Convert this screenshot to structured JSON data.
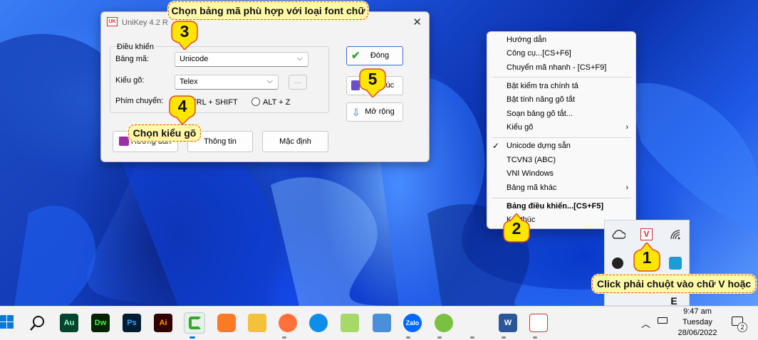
{
  "unikey": {
    "title": "UniKey 4.2 R",
    "close_icon": "✕",
    "group_title": "Điều khiển",
    "bang_ma_label": "Bảng mã:",
    "bang_ma_value": "Unicode",
    "kieu_go_label": "Kiểu gõ:",
    "kieu_go_value": "Telex",
    "ellipsis_button": "...",
    "phim_chuyen_label": "Phím chuyển:",
    "ctrl_shift_option": "CTRL + SHIFT",
    "alt_z_option": "ALT + Z",
    "dong_button": "Đóng",
    "ket_thuc_button": "Kết thúc",
    "mo_rong_button": "Mở rộng",
    "huong_dan_button": "Hướng dẫn",
    "thong_tin_button": "Thông tin",
    "mac_dinh_button": "Mặc định"
  },
  "callouts": {
    "bang_ma_hint": "Chọn bảng mã phù hợp với loại font chữ",
    "kieu_go_hint": "Chọn kiểu gõ",
    "click_hint": "Click phải chuột vào chữ V hoặc E"
  },
  "steps": [
    "1",
    "2",
    "3",
    "4",
    "5"
  ],
  "context_menu": {
    "items": [
      "Hướng dẫn",
      "Công cụ...[CS+F6]",
      "Chuyển mã nhanh - [CS+F9]",
      "Bật kiểm tra chính tả",
      "Bật tính năng gõ tắt",
      "Soạn bảng gõ tắt...",
      "Kiểu gõ",
      "Unicode dựng sẵn",
      "TCVN3 (ABC)",
      "VNI Windows",
      "Bảng mã khác",
      "Bảng điều khiển...[CS+F5]",
      "Kết thúc"
    ],
    "checked_item": "Unicode dựng sẵn"
  },
  "tray": {
    "unikey_icon_letter": "V"
  },
  "taskbar": {
    "apps": [
      {
        "name": "windows-start",
        "label": ""
      },
      {
        "name": "search",
        "label": ""
      },
      {
        "name": "audition",
        "label": "Au"
      },
      {
        "name": "dreamweaver",
        "label": "Dw"
      },
      {
        "name": "photoshop",
        "label": "Ps"
      },
      {
        "name": "illustrator",
        "label": "Ai"
      },
      {
        "name": "camtasia",
        "label": ""
      },
      {
        "name": "xampp",
        "label": ""
      },
      {
        "name": "file-explorer",
        "label": ""
      },
      {
        "name": "firefox",
        "label": ""
      },
      {
        "name": "teamviewer",
        "label": ""
      },
      {
        "name": "notepad-plus",
        "label": ""
      },
      {
        "name": "paint-tool",
        "label": ""
      },
      {
        "name": "zalo",
        "label": "Zalo"
      },
      {
        "name": "coccoc",
        "label": ""
      },
      {
        "name": "word",
        "label": "W"
      },
      {
        "name": "unikey",
        "label": ""
      }
    ],
    "clock_time": "9:47 am",
    "clock_day": "Tuesday",
    "clock_date": "28/06/2022",
    "notification_count": "2"
  },
  "colors": {
    "callout_fill": "#fff9a8",
    "callout_border": "#e5462a",
    "badge_fill": "#ffe600",
    "badge_border": "#e5462a",
    "taskbar_bg": "#f3f3f3"
  }
}
